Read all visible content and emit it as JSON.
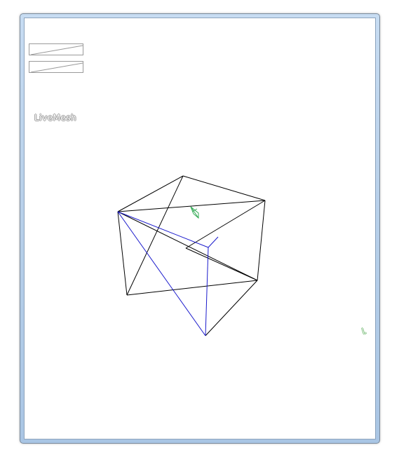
{
  "toolbar": {
    "buttons": [
      {
        "name": "view-toggle-1"
      },
      {
        "name": "view-toggle-2"
      }
    ]
  },
  "viewport": {
    "label": "LiveMesh",
    "axis_label": "\\."
  },
  "colors": {
    "frame": "#b9d1ea",
    "edges": "#000000",
    "highlight_edges": "#1a1acc",
    "marker": "#33aa55"
  }
}
